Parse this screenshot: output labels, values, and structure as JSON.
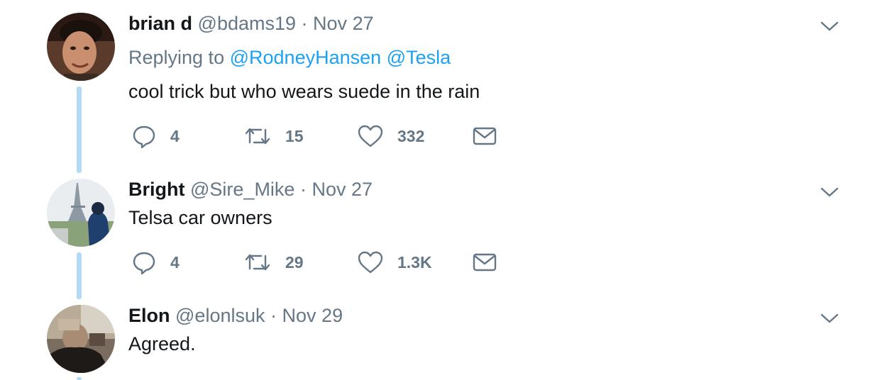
{
  "tweets": [
    {
      "name": "brian d",
      "handle": "@bdams19",
      "separator": "·",
      "date": "Nov 27",
      "reply_prefix": "Replying to",
      "mentions": [
        "@RodneyHansen",
        "@Tesla"
      ],
      "text": "cool trick but who wears suede in the rain",
      "reply_count": "4",
      "retweet_count": "15",
      "like_count": "332"
    },
    {
      "name": "Bright",
      "handle": "@Sire_Mike",
      "separator": "·",
      "date": "Nov 27",
      "text": "Telsa car owners",
      "reply_count": "4",
      "retweet_count": "29",
      "like_count": "1.3K"
    },
    {
      "name": "Elon",
      "handle": "@elonlsuk",
      "separator": "·",
      "date": "Nov 29",
      "text": "Agreed."
    }
  ],
  "icons": {
    "reply": "reply-icon",
    "retweet": "retweet-icon",
    "like": "heart-icon",
    "dm": "envelope-icon",
    "menu": "chevron-down-icon"
  },
  "colors": {
    "name": "#14171a",
    "muted": "#657786",
    "link": "#1da1f2",
    "thread_line": "#b3dbf5",
    "icon": "#657786"
  }
}
